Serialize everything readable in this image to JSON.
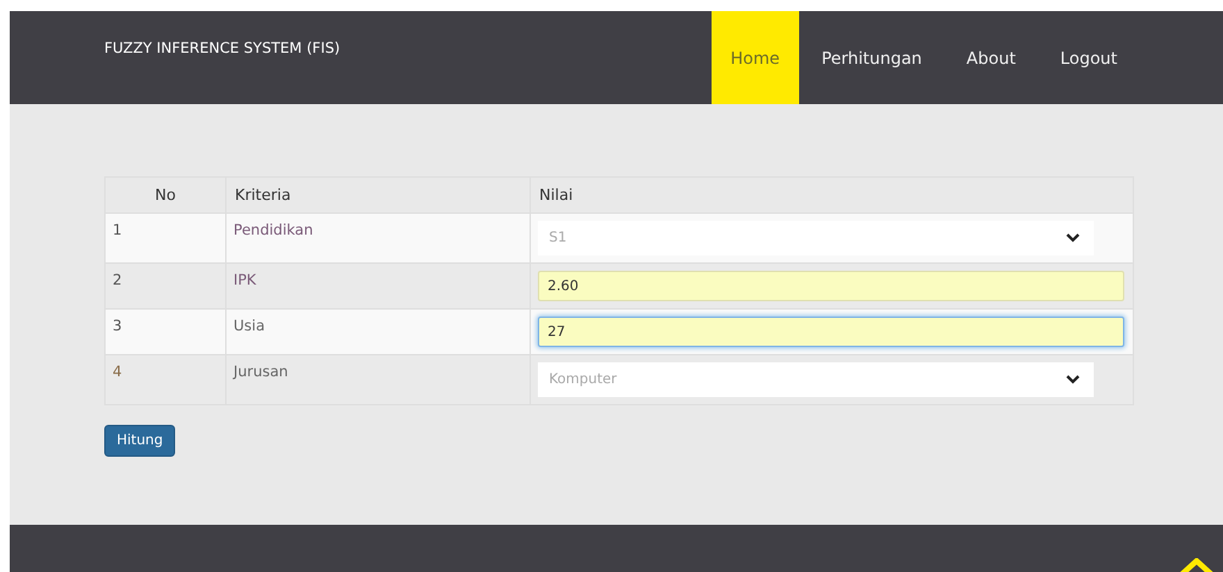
{
  "navbar": {
    "brand": "FUZZY INFERENCE SYSTEM (FIS)",
    "items": [
      {
        "label": "Home",
        "selected": true
      },
      {
        "label": "Perhitungan",
        "selected": false
      },
      {
        "label": "About",
        "selected": false
      },
      {
        "label": "Logout",
        "selected": false
      }
    ]
  },
  "table": {
    "columns": [
      "No",
      "Kriteria",
      "Nilai"
    ],
    "rows": [
      {
        "no": "1",
        "kriteria": "Pendidikan",
        "kind": "select",
        "value": "S1"
      },
      {
        "no": "2",
        "kriteria": "IPK",
        "kind": "input",
        "value": "2.60",
        "focused": false
      },
      {
        "no": "3",
        "kriteria": "Usia",
        "kind": "input",
        "value": "27",
        "focused": true
      },
      {
        "no": "4",
        "kriteria": "Jurusan",
        "kind": "select",
        "value": "Komputer"
      }
    ]
  },
  "submit_button": "Hitung"
}
